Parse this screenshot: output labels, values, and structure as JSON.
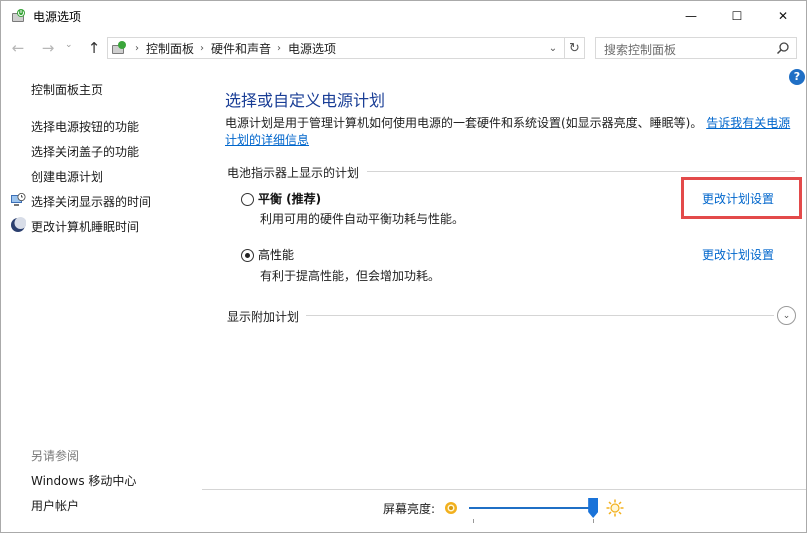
{
  "window": {
    "title": "电源选项",
    "minimize": "—",
    "maximize": "☐",
    "close": "✕"
  },
  "nav": {
    "back": "←",
    "forward": "→",
    "recent": "⌄",
    "up": "↑",
    "breadcrumb": [
      "控制面板",
      "硬件和声音",
      "电源选项"
    ],
    "separator": "›",
    "dropdown": "⌄",
    "refresh": "↻",
    "search_placeholder": "搜索控制面板"
  },
  "help_label": "?",
  "sidebar": {
    "home": "控制面板主页",
    "items": [
      "选择电源按钮的功能",
      "选择关闭盖子的功能",
      "创建电源计划",
      "选择关闭显示器的时间",
      "更改计算机睡眠时间"
    ],
    "see_also_label": "另请参阅",
    "see_also": [
      "Windows 移动中心",
      "用户帐户"
    ]
  },
  "main": {
    "title": "选择或自定义电源计划",
    "description": "电源计划是用于管理计算机如何使用电源的一套硬件和系统设置(如显示器亮度、睡眠等)。",
    "description_link": "告诉我有关电源计划的详细信息",
    "section_label": "电池指示器上显示的计划",
    "plans": [
      {
        "name": "平衡 (推荐)",
        "description": "利用可用的硬件自动平衡功耗与性能。",
        "change_link": "更改计划设置",
        "selected": false
      },
      {
        "name": "高性能",
        "description": "有利于提高性能，但会增加功耗。",
        "change_link": "更改计划设置",
        "selected": true
      }
    ],
    "more_plans": "显示附加计划",
    "expand": "⌄"
  },
  "brightness": {
    "label": "屏幕亮度:",
    "level": 0.97
  },
  "colors": {
    "title_blue": "#1a3e96",
    "link_blue": "#0066cc",
    "highlight_red": "#e34a4a",
    "slider_blue": "#1a73d9"
  }
}
